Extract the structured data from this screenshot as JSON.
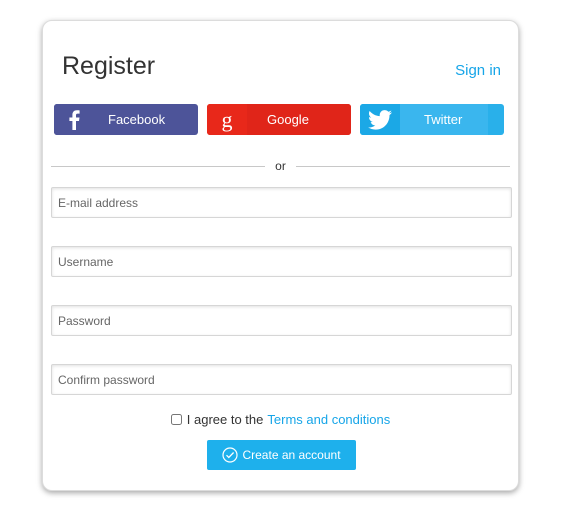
{
  "header": {
    "title": "Register",
    "signin_label": "Sign in"
  },
  "social": {
    "facebook": {
      "label": "Facebook",
      "icon": "facebook-icon",
      "color": "#4d5499"
    },
    "google": {
      "label": "Google",
      "icon": "google-icon",
      "color": "#e8281a"
    },
    "twitter": {
      "label": "Twitter",
      "icon": "twitter-icon",
      "color": "#29b0ea"
    }
  },
  "divider_label": "or",
  "form": {
    "email": {
      "placeholder": "E-mail address",
      "value": ""
    },
    "username": {
      "placeholder": "Username",
      "value": ""
    },
    "password": {
      "placeholder": "Password",
      "value": ""
    },
    "confirm": {
      "placeholder": "Confirm password",
      "value": ""
    }
  },
  "agreement": {
    "text": "I agree to the",
    "link": "Terms and conditions",
    "checked": false
  },
  "submit_label": "Create an account",
  "colors": {
    "accent": "#16a5e8",
    "button": "#1eb0ec"
  }
}
